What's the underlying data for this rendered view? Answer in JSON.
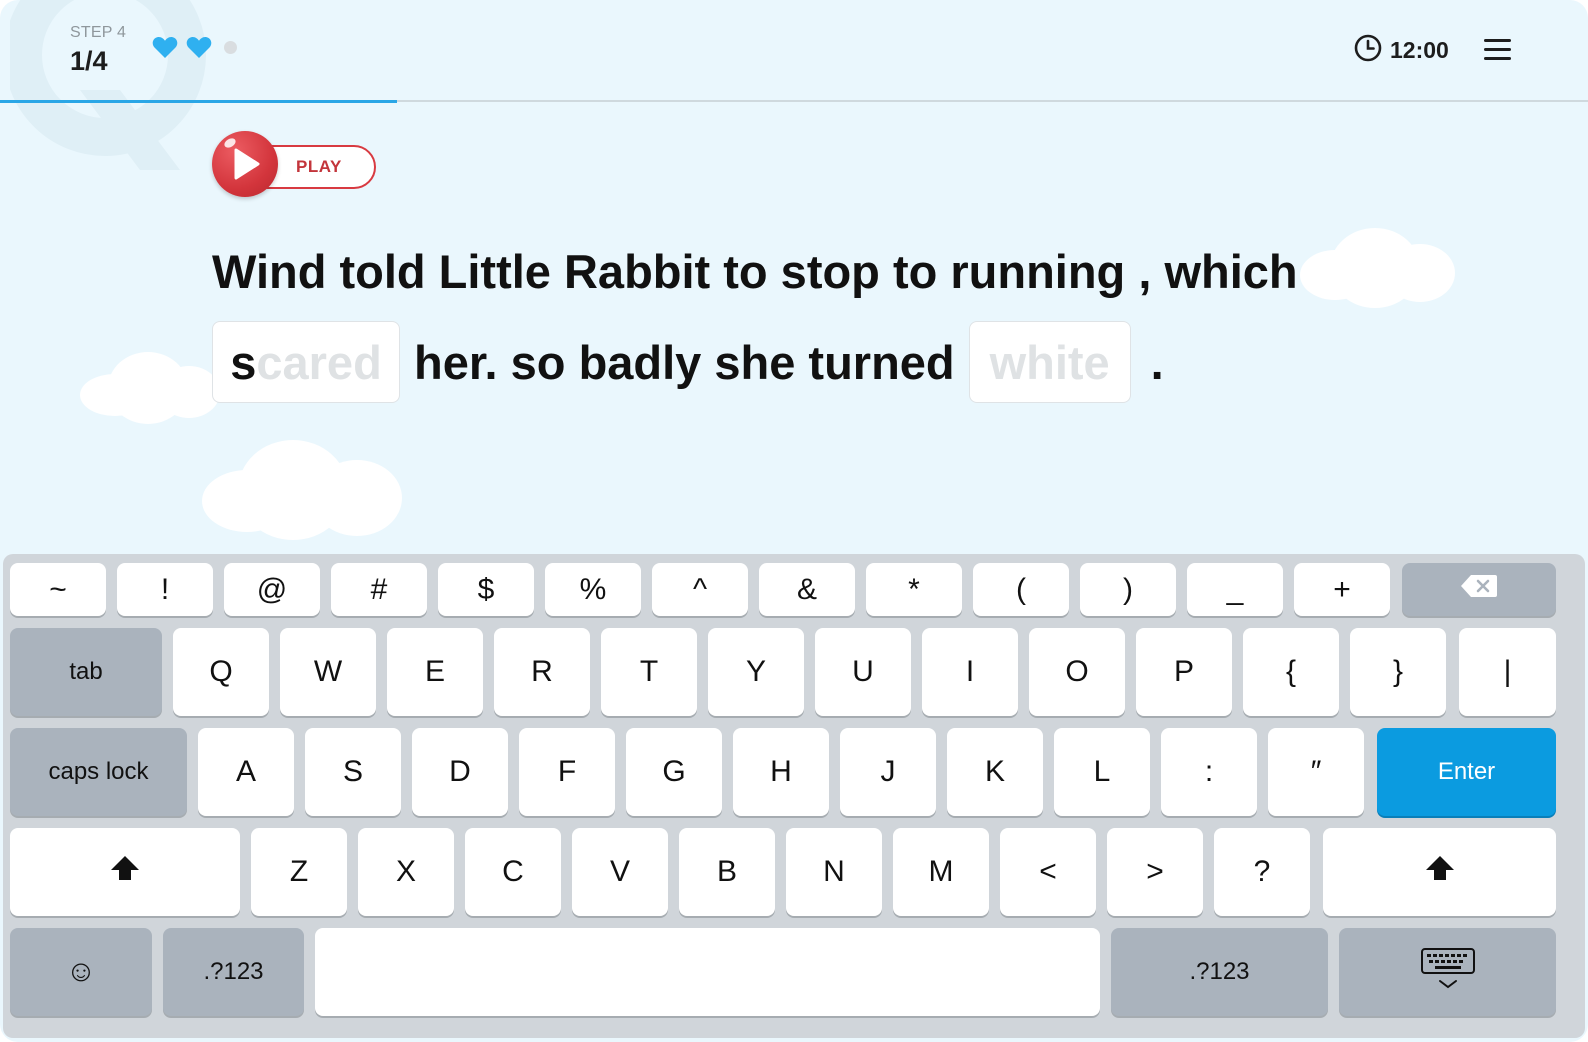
{
  "header": {
    "step_label": "STEP 4",
    "step_count": "1/4",
    "lives": {
      "filled": 2,
      "total": 3
    },
    "timer": "12:00",
    "progress_fraction": 0.25
  },
  "play": {
    "label": "PLAY"
  },
  "sentence": {
    "line1": "Wind told Little Rabbit to stop to running , which",
    "blank1": {
      "typed": "s",
      "hint": "cared"
    },
    "middle": "her. so badly she turned",
    "blank2": {
      "typed": "",
      "hint": "white"
    },
    "end": "."
  },
  "keyboard": {
    "row1": [
      "~",
      "!",
      "@",
      "#",
      "$",
      "%",
      "^",
      "&",
      "*",
      "(",
      ")",
      "_",
      "+"
    ],
    "backspace": "⌫",
    "tab": "tab",
    "row2": [
      "Q",
      "W",
      "E",
      "R",
      "T",
      "Y",
      "U",
      "I",
      "O",
      "P",
      "{",
      "}",
      "|"
    ],
    "caps": "caps lock",
    "row3": [
      "A",
      "S",
      "D",
      "F",
      "G",
      "H",
      "J",
      "K",
      "L",
      ":",
      "″"
    ],
    "enter": "Enter",
    "shift_icon": "shift-arrow-icon",
    "row4": [
      "Z",
      "X",
      "C",
      "V",
      "B",
      "N",
      "M",
      "<",
      ">",
      "?"
    ],
    "emoji": "☺",
    "numbers": ".?123",
    "space": "",
    "hide_keyboard_icon": "keyboard-hide-icon"
  },
  "colors": {
    "background": "#eaf7fd",
    "accent": "#2aa6e6",
    "play_red": "#d3353c",
    "enter_blue": "#0b9be0"
  }
}
